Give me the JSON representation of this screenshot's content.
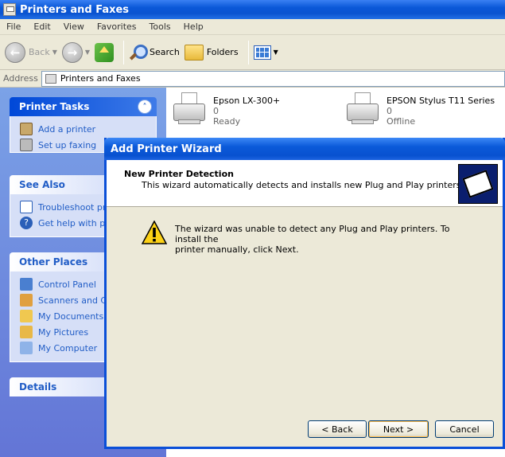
{
  "window": {
    "title": "Printers and Faxes"
  },
  "menu": [
    "File",
    "Edit",
    "View",
    "Favorites",
    "Tools",
    "Help"
  ],
  "toolbar": {
    "back": "Back",
    "search": "Search",
    "folders": "Folders"
  },
  "address": {
    "label": "Address",
    "value": "Printers and Faxes"
  },
  "tasks": {
    "printer_tasks": {
      "title": "Printer Tasks",
      "items": [
        "Add a printer",
        "Set up faxing"
      ]
    },
    "see_also": {
      "title": "See Also",
      "items": [
        "Troubleshoot printing",
        "Get help with printing"
      ]
    },
    "other_places": {
      "title": "Other Places",
      "items": [
        "Control Panel",
        "Scanners and Cameras",
        "My Documents",
        "My Pictures",
        "My Computer"
      ]
    },
    "details": {
      "title": "Details"
    }
  },
  "printers": [
    {
      "name": "Epson LX-300+",
      "docs": "0",
      "status": "Ready"
    },
    {
      "name": "EPSON Stylus T11 Series",
      "docs": "0",
      "status": "Offline"
    }
  ],
  "wizard": {
    "title": "Add Printer Wizard",
    "heading": "New Printer Detection",
    "description": "This wizard automatically detects and installs new Plug and Play printers.",
    "message_line1": "The wizard was unable to detect any Plug and Play printers. To install the",
    "message_line2": "printer manually, click Next.",
    "back": "< Back",
    "next": "Next >",
    "cancel": "Cancel"
  }
}
